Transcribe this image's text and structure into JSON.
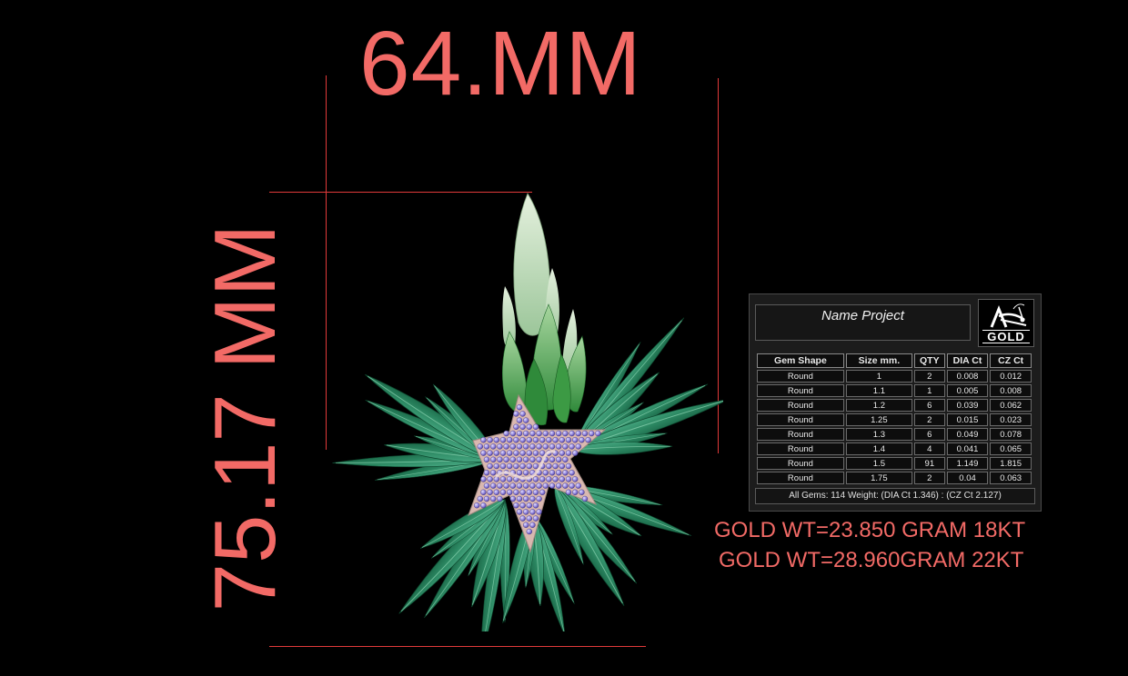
{
  "dimensions": {
    "width_label": "64.MM",
    "height_label": "75.17 MM"
  },
  "colors": {
    "dimension_text": "#f26a66",
    "dimension_line": "#e23a3a",
    "leaf_dark": "#2d8a64",
    "leaf_light": "#c8e2c6",
    "gem_purple": "#9a8fe0",
    "metal": "#d9b8b0"
  },
  "gem_panel": {
    "project_name": "Name Project",
    "logo_icon": "grasshopper-logo-icon",
    "logo_text": "GOLD",
    "columns": [
      "Gem Shape",
      "Size mm.",
      "QTY",
      "DIA Ct",
      "CZ Ct"
    ],
    "rows": [
      [
        "Round",
        "1",
        "2",
        "0.008",
        "0.012"
      ],
      [
        "Round",
        "1.1",
        "1",
        "0.005",
        "0.008"
      ],
      [
        "Round",
        "1.2",
        "6",
        "0.039",
        "0.062"
      ],
      [
        "Round",
        "1.25",
        "2",
        "0.015",
        "0.023"
      ],
      [
        "Round",
        "1.3",
        "6",
        "0.049",
        "0.078"
      ],
      [
        "Round",
        "1.4",
        "4",
        "0.041",
        "0.065"
      ],
      [
        "Round",
        "1.5",
        "91",
        "1.149",
        "1.815"
      ],
      [
        "Round",
        "1.75",
        "2",
        "0.04",
        "0.063"
      ]
    ],
    "summary": "All Gems: 114  Weight: (DIA Ct 1.346) : (CZ Ct 2.127)"
  },
  "weights": {
    "line1": "GOLD WT=23.850 GRAM 18KT",
    "line2": "GOLD WT=28.960GRAM 22KT"
  }
}
